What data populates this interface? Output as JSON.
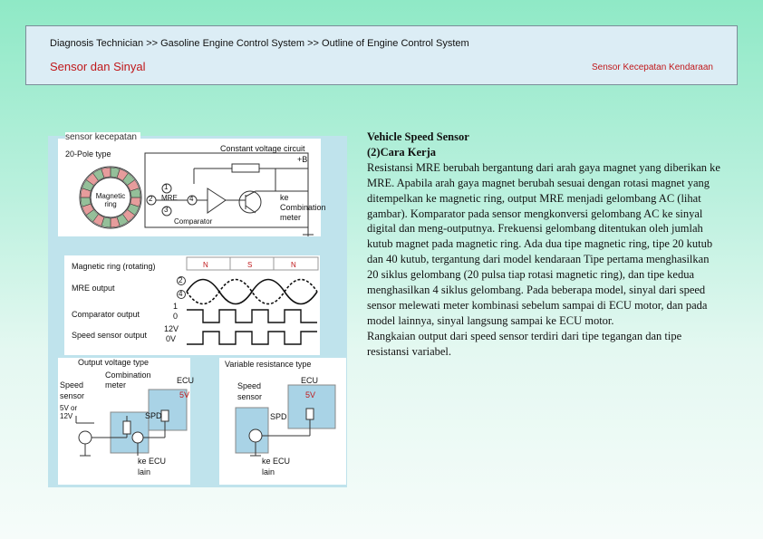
{
  "header": {
    "breadcrumb": "Diagnosis Technician >> Gasoline Engine Control System >> Outline of Engine Control System",
    "section_title": "Sensor dan Sinyal",
    "topic": "Sensor Kecepatan Kendaraan"
  },
  "figure": {
    "caption": "sensor kecepatan",
    "pole_type": "20-Pole type",
    "constant_voltage": "Constant voltage circuit",
    "plus_b": "+B",
    "magnetic_ring": "Magnetic ring",
    "mre": "MRE",
    "comparator": "Comparator",
    "to_meter": "ke Combination meter",
    "pin1": "1",
    "pin2": "2",
    "pin3": "3",
    "pin4": "4",
    "waves": {
      "magnetic_ring_rotating": "Magnetic ring (rotating)",
      "mre_output": "MRE output",
      "comparator_output": "Comparator output",
      "speed_sensor_output": "Speed sensor output",
      "n": "N",
      "s": "S",
      "pin2": "2",
      "pin4": "4",
      "one": "1",
      "zero": "0",
      "v12": "12V",
      "v0": "0V"
    },
    "output_voltage": {
      "type": "Output voltage type",
      "speed_sensor": "Speed sensor",
      "combination_meter": "Combination meter",
      "ecu": "ECU",
      "v5": "5V",
      "supply": "5V or 12V",
      "spd": "SPD",
      "to_ecu": "ke ECU lain"
    },
    "variable_resistance": {
      "type": "Variable resistance type",
      "speed_sensor": "Speed sensor",
      "ecu": "ECU",
      "v5": "5V",
      "spd": "SPD",
      "to_ecu": "ke ECU lain"
    }
  },
  "description": {
    "title": "Vehicle Speed Sensor",
    "subtitle": "(2)Cara Kerja",
    "body": "Resistansi MRE berubah bergantung dari arah gaya magnet yang diberikan ke MRE. Apabila arah gaya magnet berubah sesuai dengan rotasi magnet yang ditempelkan ke magnetic ring, output MRE menjadi gelombang AC (lihat gambar). Komparator pada sensor mengkonversi gelombang AC ke sinyal digital dan meng-outputnya. Frekuensi gelombang ditentukan oleh jumlah kutub magnet pada magnetic ring. Ada dua tipe magnetic ring, tipe 20 kutub dan 40 kutub, tergantung dari model kendaraan Tipe pertama menghasilkan 20 siklus gelombang (20 pulsa tiap rotasi magnetic ring), dan tipe kedua menghasilkan 4 siklus gelombang. Pada beberapa model, sinyal dari speed sensor melewati meter kombinasi sebelum sampai di ECU motor, dan pada model lainnya, sinyal langsung sampai ke ECU motor.",
    "body2": "Rangkaian output dari speed sensor terdiri dari tipe tegangan dan tipe resistansi variabel."
  },
  "colors": {
    "title_red": "#c0181b",
    "figure_bg": "#bfe3ec",
    "ecu_blue": "#a9d3e6",
    "pole_red": "#d24a4a",
    "pole_green": "#3d8a45"
  }
}
